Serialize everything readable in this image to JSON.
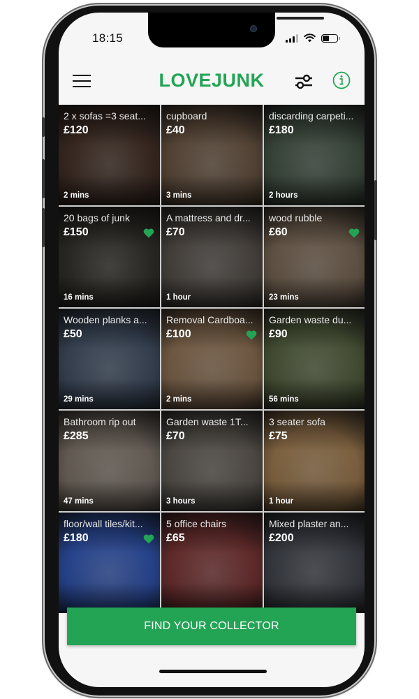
{
  "status_bar": {
    "time": "18:15",
    "battery_level": 0.45
  },
  "header": {
    "brand": "LOVEJUNK",
    "menu_icon": "hamburger-menu-icon",
    "filter_icon": "sliders-filter-icon",
    "info_icon": "info-circle-icon"
  },
  "colors": {
    "brand": "#23a455",
    "heart": "#23a455",
    "background": "#f6f6f6"
  },
  "listings": [
    {
      "title": "2 x sofas =3 seat...",
      "price": "£120",
      "age": "2 mins",
      "favorited": false,
      "bg": "#3b2a22"
    },
    {
      "title": "cupboard",
      "price": "£40",
      "age": "3 mins",
      "favorited": false,
      "bg": "#5c4a3a"
    },
    {
      "title": "discarding carpeti...",
      "price": "£180",
      "age": "2 hours",
      "favorited": false,
      "bg": "#3d4a3e"
    },
    {
      "title": "20 bags of junk",
      "price": "£150",
      "age": "16 mins",
      "favorited": true,
      "bg": "#2d2b26"
    },
    {
      "title": "A mattress and dr...",
      "price": "£70",
      "age": "1 hour",
      "favorited": false,
      "bg": "#4a4540"
    },
    {
      "title": "wood rubble",
      "price": "£60",
      "age": "23 mins",
      "favorited": true,
      "bg": "#6a5a4a"
    },
    {
      "title": "Wooden planks a...",
      "price": "£50",
      "age": "29 mins",
      "favorited": false,
      "bg": "#3a4658"
    },
    {
      "title": "Removal Cardboa...",
      "price": "£100",
      "age": "2 mins",
      "favorited": true,
      "bg": "#7a6148"
    },
    {
      "title": "Garden waste du...",
      "price": "£90",
      "age": "56 mins",
      "favorited": false,
      "bg": "#4a5538"
    },
    {
      "title": "Bathroom rip out",
      "price": "£285",
      "age": "47 mins",
      "favorited": false,
      "bg": "#6e655c"
    },
    {
      "title": "Garden waste 1T...",
      "price": "£70",
      "age": "3 hours",
      "favorited": false,
      "bg": "#55504a"
    },
    {
      "title": "3 seater sofa",
      "price": "£75",
      "age": "1 hour",
      "favorited": false,
      "bg": "#8a6a45"
    },
    {
      "title": "floor/wall tiles/kit...",
      "price": "£180",
      "age": "",
      "favorited": true,
      "bg": "#2a4a9a"
    },
    {
      "title": "5 office chairs",
      "price": "£65",
      "age": "",
      "favorited": false,
      "bg": "#6a2e2e"
    },
    {
      "title": "Mixed plaster an...",
      "price": "£200",
      "age": "",
      "favorited": false,
      "bg": "#3a3d44"
    }
  ],
  "cta": {
    "label": "FIND YOUR COLLECTOR"
  }
}
